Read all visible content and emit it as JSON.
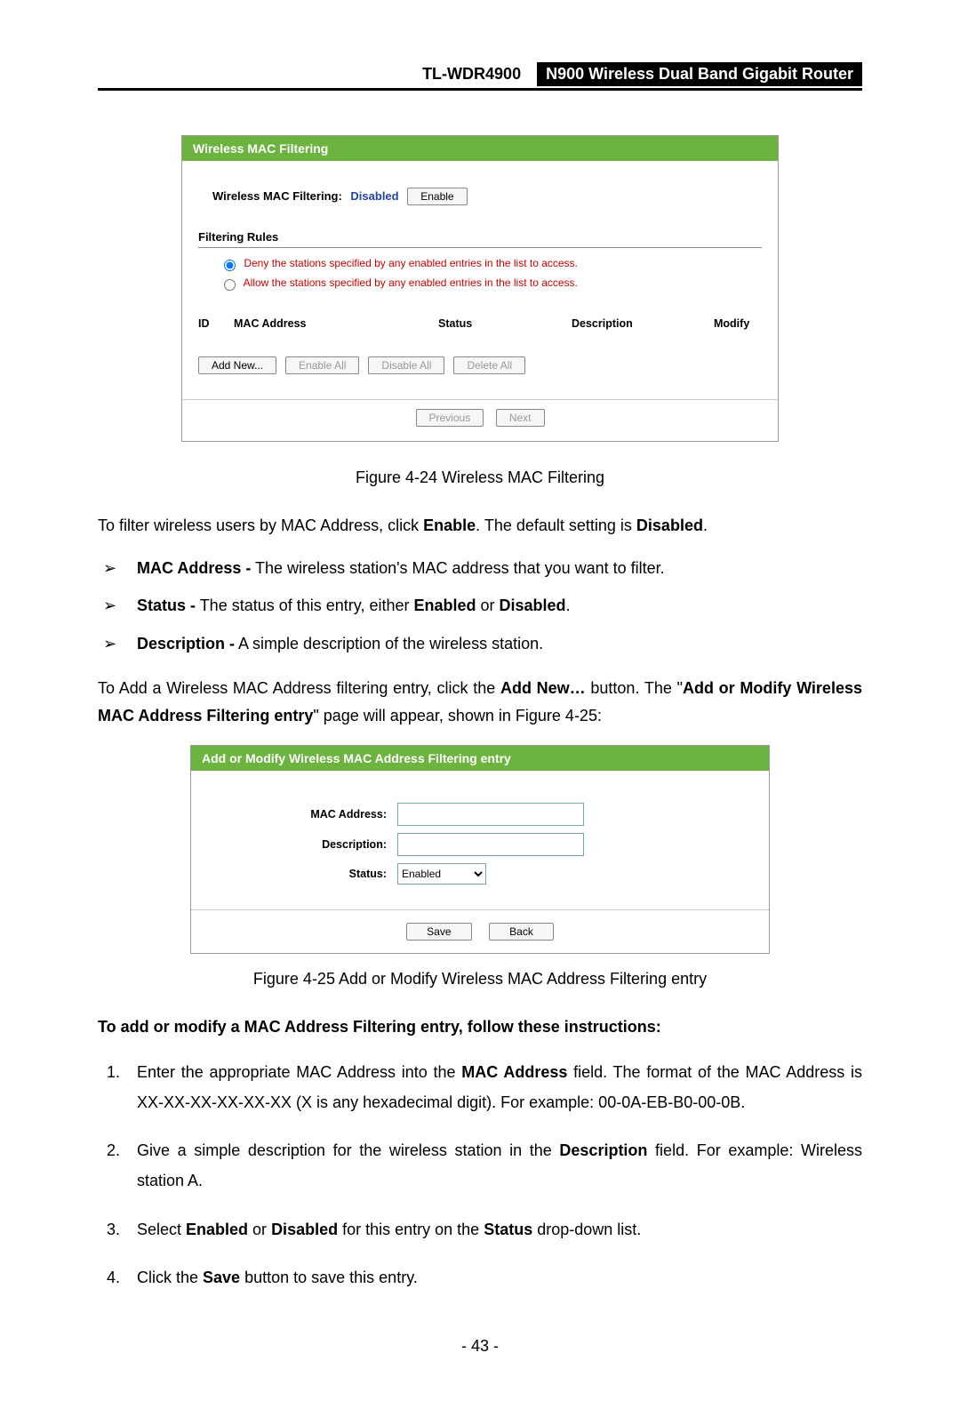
{
  "header": {
    "model": "TL-WDR4900",
    "title": "N900 Wireless Dual Band Gigabit Router"
  },
  "fig24": {
    "header": "Wireless MAC Filtering",
    "statusLabel": "Wireless MAC Filtering:",
    "statusValue": "Disabled",
    "enableBtn": "Enable",
    "rulesHeading": "Filtering Rules",
    "denyText": "Deny the stations specified by any enabled entries in the list to access.",
    "allowText": "Allow the stations specified by any enabled entries in the list to access.",
    "cols": {
      "id": "ID",
      "mac": "MAC Address",
      "status": "Status",
      "desc": "Description",
      "mod": "Modify"
    },
    "btns": {
      "add": "Add New...",
      "enableAll": "Enable All",
      "disableAll": "Disable All",
      "deleteAll": "Delete All",
      "prev": "Previous",
      "next": "Next"
    }
  },
  "caption24": "Figure 4-24 Wireless MAC Filtering",
  "p1a": "To filter wireless users by MAC Address, click ",
  "p1b": "Enable",
  "p1c": ". The default setting is ",
  "p1d": "Disabled",
  "p1e": ".",
  "bullets": {
    "b1a": "MAC Address -",
    "b1b": " The wireless station's MAC address that you want to filter.",
    "b2a": "Status -",
    "b2b": " The status of this entry, either ",
    "b2c": "Enabled",
    "b2d": " or ",
    "b2e": "Disabled",
    "b2f": ".",
    "b3a": "Description -",
    "b3b": " A simple description of the wireless station."
  },
  "p2a": "To Add a Wireless MAC Address filtering entry, click the ",
  "p2b": "Add New…",
  "p2c": " button. The \"",
  "p2d": "Add or Modify Wireless MAC Address Filtering entry",
  "p2e": "\" page will appear, shown in Figure 4-25:",
  "fig25": {
    "header": "Add or Modify Wireless MAC Address Filtering entry",
    "macLabel": "MAC Address:",
    "descLabel": "Description:",
    "statusLabel": "Status:",
    "statusValue": "Enabled",
    "save": "Save",
    "back": "Back"
  },
  "caption25": "Figure 4-25 Add or Modify Wireless MAC Address Filtering entry",
  "instrHeading": "To add or modify a MAC Address Filtering entry, follow these instructions:",
  "steps": {
    "s1a": "Enter the appropriate MAC Address into the ",
    "s1b": "MAC Address",
    "s1c": " field. The format of the MAC Address is XX-XX-XX-XX-XX-XX (X is any hexadecimal digit). For example: 00-0A-EB-B0-00-0B.",
    "s2a": "Give a simple description for the wireless station in the ",
    "s2b": "Description",
    "s2c": " field. For example: Wireless station A.",
    "s3a": "Select ",
    "s3b": "Enabled",
    "s3c": " or ",
    "s3d": "Disabled",
    "s3e": " for this entry on the ",
    "s3f": "Status",
    "s3g": " drop-down list.",
    "s4a": "Click the ",
    "s4b": "Save",
    "s4c": " button to save this entry."
  },
  "pageNumber": "- 43 -"
}
